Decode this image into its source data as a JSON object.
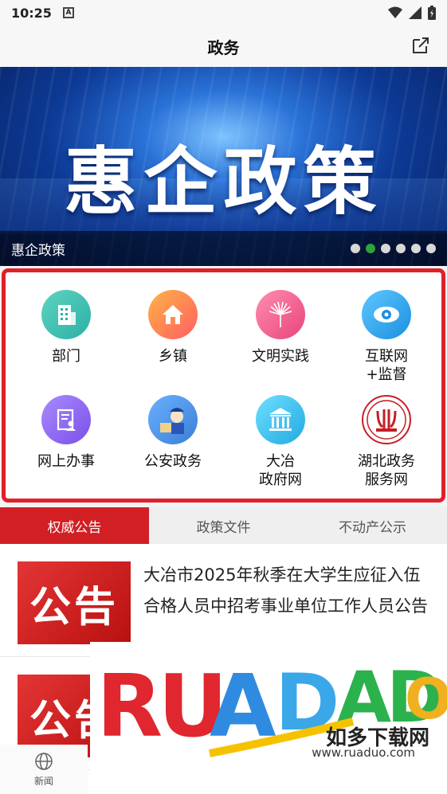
{
  "status_bar": {
    "time": "10:25",
    "sim_label": "A"
  },
  "header": {
    "title": "政务"
  },
  "banner": {
    "headline": "惠企政策",
    "caption": "惠企政策",
    "dot_count": 6,
    "active_dot": 1
  },
  "services": [
    {
      "label": "部门",
      "icon": "building-icon",
      "color_from": "#5fd3c0",
      "color_to": "#2bb0a6"
    },
    {
      "label": "乡镇",
      "icon": "house-icon",
      "color_from": "#ffb347",
      "color_to": "#ff5e62"
    },
    {
      "label": "文明实践",
      "icon": "palm-leaf-icon",
      "color_from": "#ff8fb1",
      "color_to": "#e8437a"
    },
    {
      "label": "互联网\n+监督",
      "icon": "eye-icon",
      "color_from": "#5ec7ff",
      "color_to": "#1b8fe0"
    },
    {
      "label": "网上办事",
      "icon": "document-user-icon",
      "color_from": "#a98bff",
      "color_to": "#7a4fe8"
    },
    {
      "label": "公安政务",
      "icon": "police-icon",
      "color_from": "#6ab0ff",
      "color_to": "#3b7fd6"
    },
    {
      "label": "大冶\n政府网",
      "icon": "government-building-icon",
      "color_from": "#6ee0ff",
      "color_to": "#22a9e0"
    },
    {
      "label": "湖北政务\n服务网",
      "icon": "hubei-seal-icon",
      "color_from": "#ffffff",
      "color_to": "#ffffff"
    }
  ],
  "tabs": [
    {
      "label": "权威公告",
      "active": true
    },
    {
      "label": "政策文件",
      "active": false
    },
    {
      "label": "不动产公示",
      "active": false
    }
  ],
  "news": [
    {
      "thumb_text": "公告",
      "title": "大冶市2025年秋季在大学生应征入伍合格人员中招考事业单位工作人员公告"
    },
    {
      "thumb_text": "公告",
      "title": ""
    }
  ],
  "bottom_nav": {
    "label": "新闻",
    "icon": "globe-icon"
  },
  "watermark": {
    "logo_text": "RUADADO",
    "tagline": "如多下载网",
    "url": "www.ruaduo.com"
  }
}
